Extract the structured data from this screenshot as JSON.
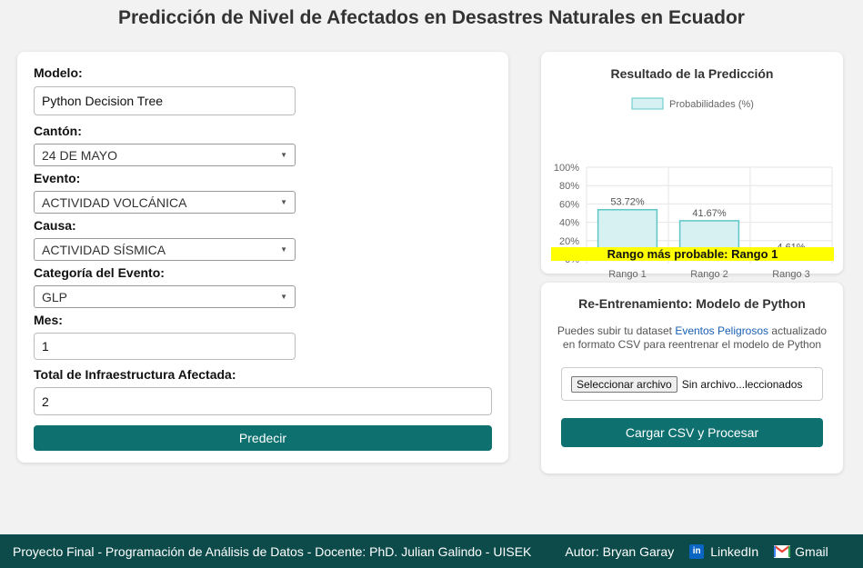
{
  "page": {
    "title": "Predicción de Nivel de Afectados en Desastres Naturales en Ecuador"
  },
  "form": {
    "modelo_label": "Modelo:",
    "modelo_value": "Python Decision Tree",
    "canton_label": "Cantón:",
    "canton_value": "24 DE MAYO",
    "evento_label": "Evento:",
    "evento_value": "ACTIVIDAD VOLCÁNICA",
    "causa_label": "Causa:",
    "causa_value": "ACTIVIDAD SÍSMICA",
    "categoria_label": "Categoría del Evento:",
    "categoria_value": "GLP",
    "mes_label": "Mes:",
    "mes_value": "1",
    "infra_label": "Total de Infraestructura Afectada:",
    "infra_value": "2",
    "predict_button": "Predecir"
  },
  "result": {
    "title": "Resultado de la Predicción",
    "most_probable": "Rango más probable: Rango 1"
  },
  "chart_data": {
    "type": "bar",
    "categories": [
      "Rango 1",
      "Rango 2",
      "Rango 3"
    ],
    "series": [
      {
        "name": "Probabilidades (%)",
        "values": [
          53.72,
          41.67,
          4.61
        ]
      }
    ],
    "data_labels": [
      "53.72%",
      "41.67%",
      "4.61%"
    ],
    "yticks": [
      "0%",
      "20%",
      "40%",
      "60%",
      "80%",
      "100%"
    ],
    "ylim": [
      0,
      100
    ],
    "grid": true,
    "legend": "top",
    "colors": {
      "fill": "#d7f1f2",
      "stroke": "#5ec8c8"
    }
  },
  "retrain": {
    "title": "Re-Entrenamiento: Modelo de Python",
    "desc_prefix": "Puedes subir tu dataset",
    "desc_link": "Eventos Peligrosos",
    "desc_suffix": "actualizado en formato CSV para reentrenar el modelo de Python",
    "file_button": "Seleccionar archivo",
    "file_status": "Sin archivo...leccionados",
    "upload_button": "Cargar CSV y Procesar"
  },
  "footer": {
    "credit": "Proyecto Final - Programación de Análisis de Datos - Docente: PhD. Julian Galindo - UISEK",
    "author": "Autor: Bryan Garay",
    "linkedin": "LinkedIn",
    "gmail": "Gmail"
  },
  "colors": {
    "accent": "#0f7070",
    "footer_bg": "#0d4b4b",
    "highlight": "#ffff00",
    "link": "#1a5fb4"
  }
}
